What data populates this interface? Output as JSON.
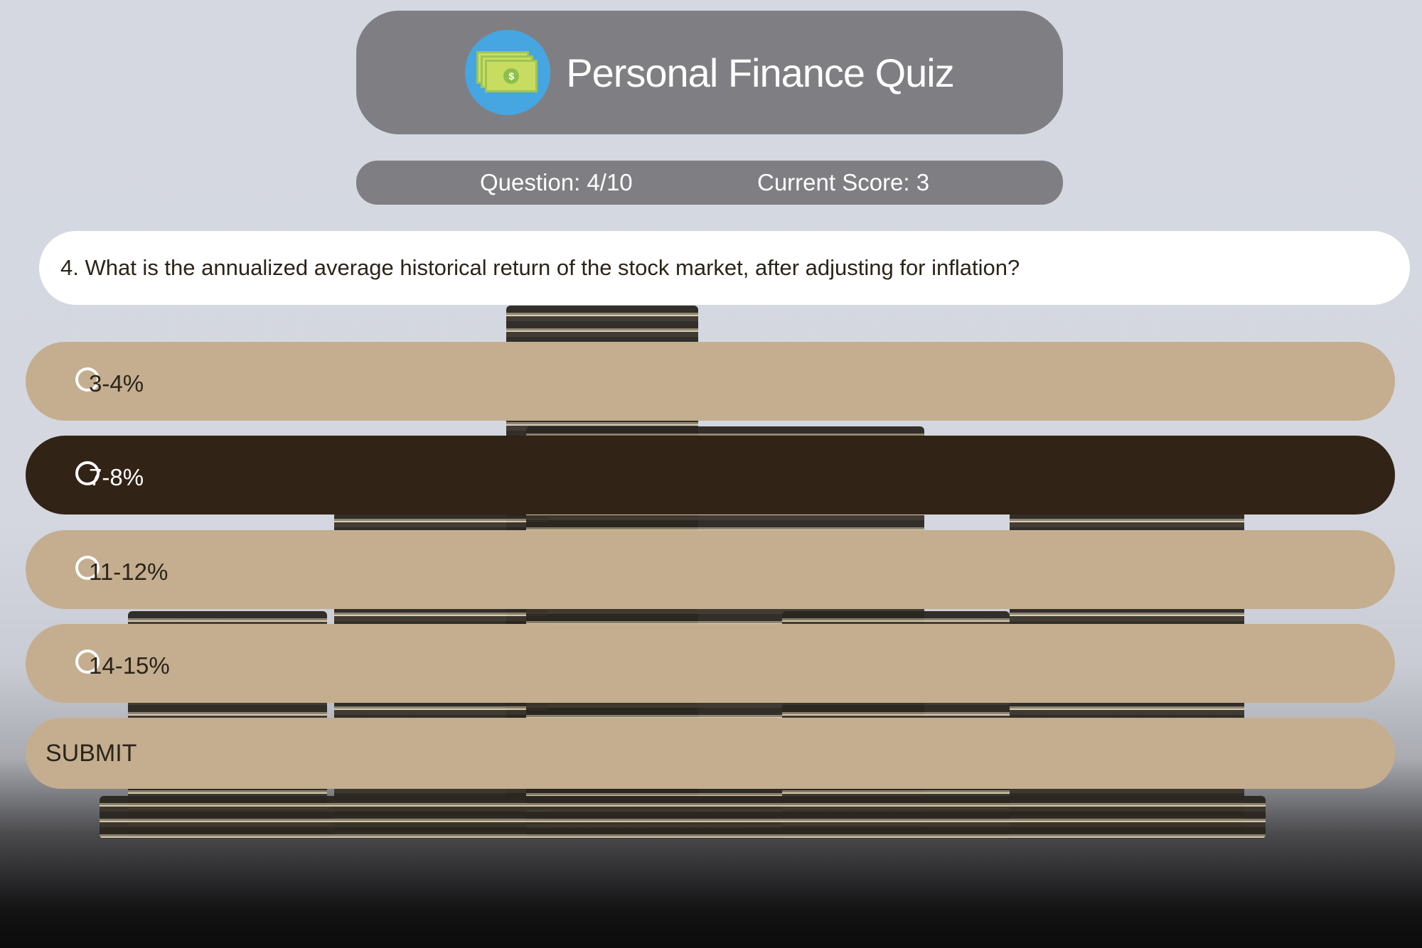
{
  "header": {
    "title": "Personal Finance Quiz",
    "logo_icon": "money-bills-icon",
    "logo_symbol": "$"
  },
  "stats": {
    "question": "Question: 4/10",
    "score": "Current Score: 3"
  },
  "question": {
    "text": "4. What is the annualized average historical return of the stock market, after adjusting for inflation?"
  },
  "options": [
    {
      "label": "3-4%",
      "selected": false
    },
    {
      "label": "7-8%",
      "selected": true
    },
    {
      "label": "11-12%",
      "selected": false
    },
    {
      "label": "14-15%",
      "selected": false
    }
  ],
  "submit_label": "SUBMIT",
  "colors": {
    "option": "#c4ae8f",
    "option_selected": "#312316",
    "header": "#7f7f83",
    "logo_bg": "#46a6e2"
  }
}
